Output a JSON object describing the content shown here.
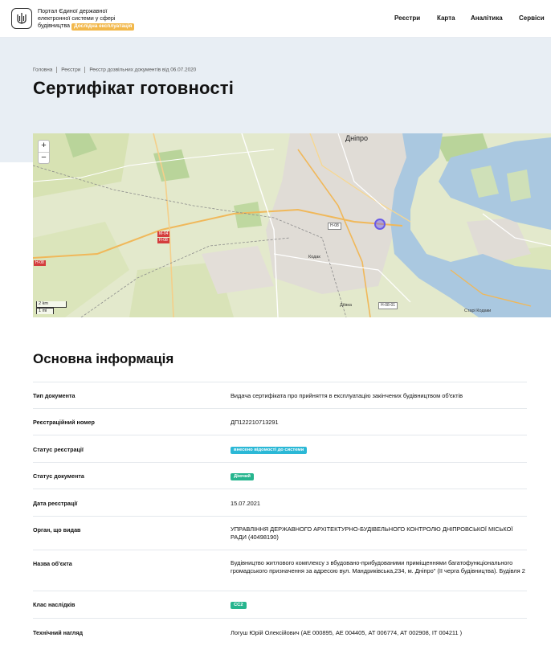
{
  "header": {
    "brand_line1": "Портал Єдиної державної",
    "brand_line2": "електронної системи у сфері",
    "brand_line3": "будівництва",
    "brand_badge": "Дослідна експлуатація",
    "nav": [
      "Реєстри",
      "Карта",
      "Аналітика",
      "Сервіси"
    ]
  },
  "breadcrumbs": [
    "Головна",
    "Реєстри",
    "Реєстр дозвільних документів від 06.07.2020"
  ],
  "page_title": "Сертифікат готовності",
  "map": {
    "zoom_in": "+",
    "zoom_out": "−",
    "scale_metric": "2 km",
    "scale_imperial": "1 mi",
    "labels": {
      "city": "Дніпро",
      "road1": "H-08",
      "road2": "M-04",
      "road3": "H-08",
      "road4": "H-08",
      "road5": "H-08-01",
      "district1": "Кодак",
      "district2": "Діївка",
      "district3": "Старі Кодаки"
    }
  },
  "section_title": "Основна інформація",
  "rows": [
    {
      "label": "Тип документа",
      "value": "Видача сертифіката про прийняття в експлуатацію закінчених будівництвом об'єктів"
    },
    {
      "label": "Реєстраційний номер",
      "value": "ДП122210713291"
    },
    {
      "label": "Статус реєстрації",
      "value": "внесено відомості до системи"
    },
    {
      "label": "Статус документа",
      "value": "Діючий"
    },
    {
      "label": "Дата реєстрації",
      "value": "15.07.2021"
    },
    {
      "label": "Орган, що видав",
      "value": "УПРАВЛІННЯ ДЕРЖАВНОГО АРХІТЕКТУРНО-БУДІВЕЛЬНОГО КОНТРОЛЮ ДНІПРОВСЬКОЇ МІСЬКОЇ РАДИ (40498190)"
    },
    {
      "label": "Назва об'єкта",
      "value": "Будівництво житлового комплексу з вбудовано-прибудованими приміщеннями багатофункціонального громадського призначення за адресою вул. Мандриківська,234, м. Дніпро\" (ІІ черга будівництва). Будівля 2"
    },
    {
      "label": "Клас наслідків",
      "value": "СС2"
    },
    {
      "label": "Технічний нагляд",
      "value": "Логуш Юрій Олексійович (АЕ 000895, АЕ 004405, АТ 006774, АТ 002908, ІТ 004211 )"
    }
  ],
  "colors": {
    "accent_badge": "#f2b84b",
    "status_blue": "#2bb8d6",
    "status_green": "#26b58e",
    "hero_bg": "#e8eef4"
  }
}
